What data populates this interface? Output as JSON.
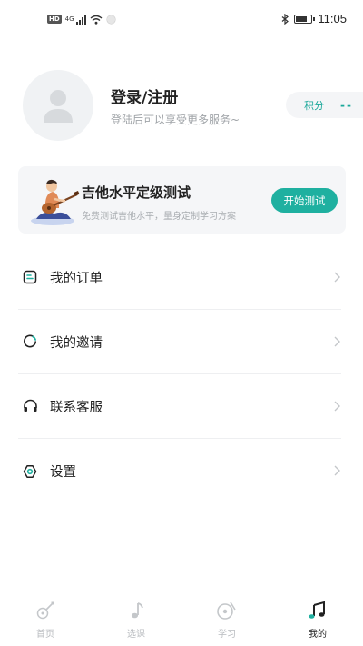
{
  "status_bar": {
    "hd": "HD",
    "network": "4G",
    "time": "11:05",
    "battery_level": 0.75
  },
  "profile": {
    "title": "登录/注册",
    "subtitle": "登陆后可以享受更多服务~",
    "points_label": "积分",
    "points_value": "--",
    "avatar_icon": "user-placeholder-icon"
  },
  "test_card": {
    "title": "吉他水平定级测试",
    "subtitle": "免费测试吉他水平，量身定制学习方案",
    "button_label": "开始测试",
    "illustration": "guitarist-illustration"
  },
  "menu": {
    "items": [
      {
        "label": "我的订单",
        "icon": "order-icon"
      },
      {
        "label": "我的邀请",
        "icon": "invite-icon"
      },
      {
        "label": "联系客服",
        "icon": "headset-icon"
      },
      {
        "label": "设置",
        "icon": "settings-icon"
      }
    ]
  },
  "bottom_nav": {
    "items": [
      {
        "label": "首页",
        "icon": "guitar-icon",
        "active": false
      },
      {
        "label": "选课",
        "icon": "music-note-icon",
        "active": false
      },
      {
        "label": "学习",
        "icon": "vinyl-icon",
        "active": false
      },
      {
        "label": "我的",
        "icon": "music-notes-icon",
        "active": true
      }
    ]
  },
  "colors": {
    "accent": "#1fb0a0",
    "text": "#222222",
    "muted": "#a0a4a8",
    "card_bg": "#f5f6f8"
  }
}
